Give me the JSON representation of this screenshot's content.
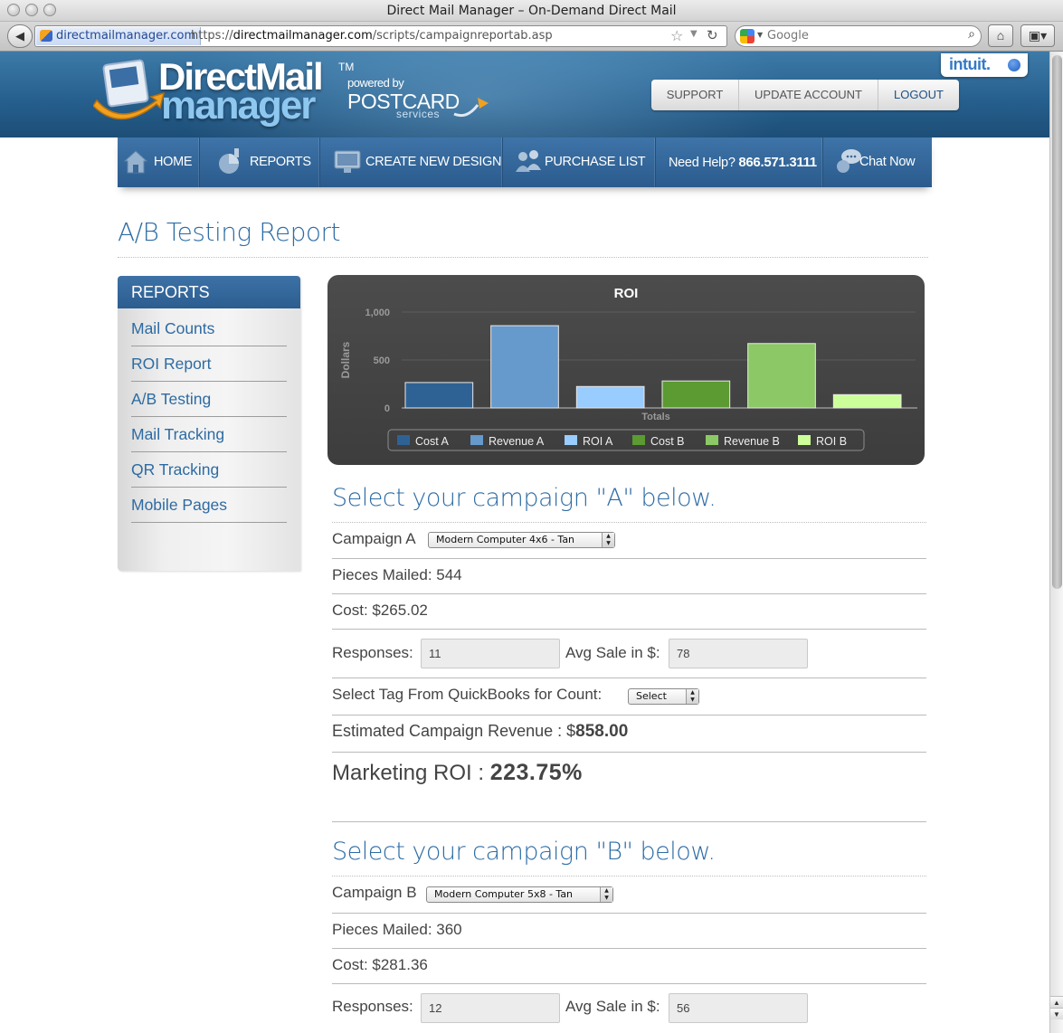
{
  "browser": {
    "window_title": "Direct Mail Manager – On-Demand Direct Mail",
    "site_identity": "directmailmanager.com",
    "url_prefix": "https://",
    "url_domain": "directmailmanager.com",
    "url_path": "/scripts/campaignreportab.asp",
    "search_placeholder": "Google"
  },
  "header": {
    "logo_line1": "DirectMail",
    "logo_line2": "manager",
    "logo_tm": "TM",
    "powered_by": "powered by",
    "postcard": "POSTCARD",
    "services": "services",
    "intuit": "intuit.",
    "account_links": [
      "SUPPORT",
      "UPDATE ACCOUNT",
      "LOGOUT"
    ]
  },
  "nav": {
    "home": "HOME",
    "reports": "REPORTS",
    "create_new_design": "CREATE NEW DESIGN",
    "purchase_list": "PURCHASE LIST",
    "need_help": "Need Help?",
    "phone": "866.571.3111",
    "chat_now": "Chat Now"
  },
  "page": {
    "title": "A/B Testing Report"
  },
  "sidebar": {
    "heading": "REPORTS",
    "items": [
      "Mail Counts",
      "ROI Report",
      "A/B Testing",
      "Mail Tracking",
      "QR Tracking",
      "Mobile Pages"
    ]
  },
  "chart_data": {
    "type": "bar",
    "title": "ROI",
    "xlabel": "Totals",
    "ylabel": "Dollars",
    "ylim": [
      0,
      1000
    ],
    "yticks": [
      "0",
      "500",
      "1,000"
    ],
    "grid": true,
    "legend_position": "bottom",
    "series": [
      {
        "name": "Cost A",
        "value": 265.02,
        "color": "#2f6294"
      },
      {
        "name": "Revenue A",
        "value": 858.0,
        "color": "#6699cc"
      },
      {
        "name": "ROI A",
        "value": 223.75,
        "color": "#99ccff"
      },
      {
        "name": "Cost B",
        "value": 281.36,
        "color": "#5c9a32"
      },
      {
        "name": "Revenue B",
        "value": 672.0,
        "color": "#8cc865"
      },
      {
        "name": "ROI B",
        "value": 138.84,
        "color": "#ccff99"
      }
    ]
  },
  "campaign_a": {
    "heading": "Select your campaign \"A\" below.",
    "campaign_label": "Campaign A",
    "campaign_value": "Modern Computer 4x6 - Tan",
    "pieces_mailed": "Pieces Mailed: 544",
    "cost": "Cost: $265.02",
    "responses_label": "Responses:",
    "responses_value": "11",
    "avg_sale_label": "Avg Sale in $:",
    "avg_sale_value": "78",
    "tag_label": "Select Tag From QuickBooks for Count:",
    "tag_value": "Select",
    "revenue_label": "Estimated Campaign Revenue : $",
    "revenue_value": "858.00",
    "roi_label": "Marketing ROI : ",
    "roi_value": "223.75%"
  },
  "campaign_b": {
    "heading": "Select your campaign \"B\" below.",
    "campaign_label": "Campaign B",
    "campaign_value": "Modern Computer 5x8 - Tan",
    "pieces_mailed": "Pieces Mailed: 360",
    "cost": "Cost: $281.36",
    "responses_label": "Responses:",
    "responses_value": "12",
    "avg_sale_label": "Avg Sale in $:",
    "avg_sale_value": "56"
  }
}
